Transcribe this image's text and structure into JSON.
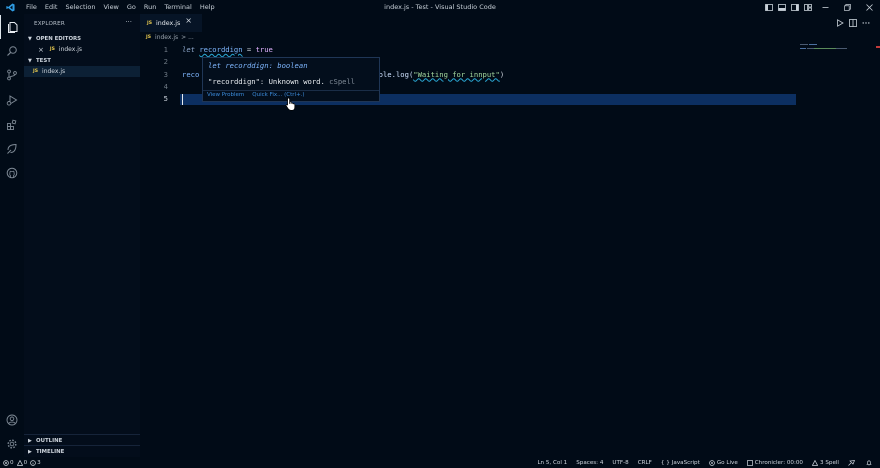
{
  "window": {
    "title": "index.js - Test - Visual Studio Code",
    "menu": [
      "File",
      "Edit",
      "Selection",
      "View",
      "Go",
      "Run",
      "Terminal",
      "Help"
    ]
  },
  "sidebar": {
    "header": "EXPLORER",
    "more": "···",
    "open_editors": {
      "label": "OPEN EDITORS",
      "items": [
        {
          "badge": "JS",
          "name": "index.js"
        }
      ]
    },
    "folder": {
      "label": "TEST",
      "items": [
        {
          "badge": "JS",
          "name": "index.js"
        }
      ]
    },
    "outline": "OUTLINE",
    "timeline": "TIMELINE"
  },
  "tab": {
    "badge": "JS",
    "name": "index.js"
  },
  "breadcrumb": {
    "badge": "JS",
    "file": "index.js",
    "rest": "> ..."
  },
  "editor": {
    "lines": [
      {
        "num": "1",
        "kw": "let",
        "var": "recorddign",
        "op": " = ",
        "val": "true"
      },
      {
        "num": "2"
      },
      {
        "num": "3",
        "prefix": "reco",
        "suffix": "nsole.log(",
        "str": "\"Waiting for innput\"",
        "close": ")"
      },
      {
        "num": "4"
      },
      {
        "num": "5"
      }
    ]
  },
  "hover": {
    "signature_kw": "let",
    "signature_name": "recorddign",
    "signature_type": ": boolean",
    "message": "\"recorddign\": Unknown word.",
    "source": "cSpell",
    "view_problem": "View Problem",
    "quick_fix": "Quick Fix... (Ctrl+.)"
  },
  "status": {
    "errors": "0",
    "warnings": "0",
    "info": "3",
    "position": "Ln 5, Col 1",
    "spaces": "Spaces: 4",
    "encoding": "UTF-8",
    "eol": "CRLF",
    "language": "JavaScript",
    "golive": "Go Live",
    "chronicler": "Chronicler: 00:00",
    "spell": "3 Spell"
  },
  "colors": {
    "background": "#010b17",
    "current_line": "#0c2f61",
    "link": "#3c8dde",
    "squiggle": "#2aa9d6"
  }
}
